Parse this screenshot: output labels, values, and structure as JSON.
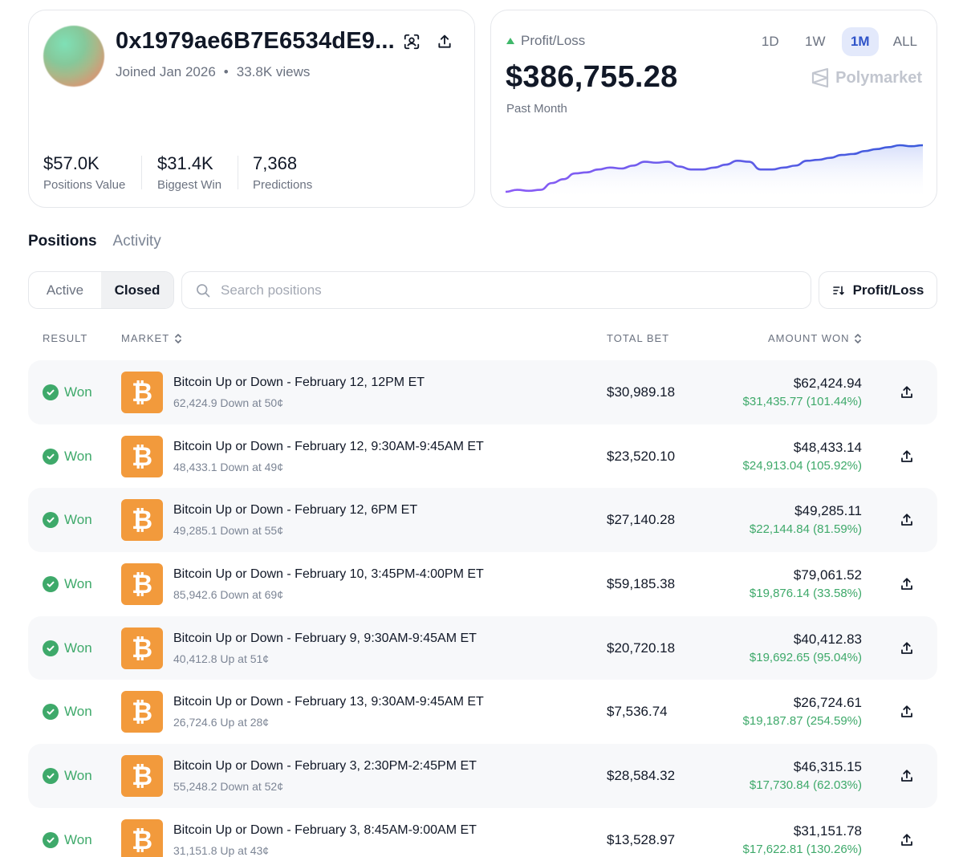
{
  "profile": {
    "address": "0x1979ae6B7E6534dE9...",
    "joined": "Joined Jan 2026",
    "views": "33.8K views",
    "stats": [
      {
        "value": "$57.0K",
        "label": "Positions Value"
      },
      {
        "value": "$31.4K",
        "label": "Biggest Win"
      },
      {
        "value": "7,368",
        "label": "Predictions"
      }
    ]
  },
  "profit_loss": {
    "title": "Profit/Loss",
    "value": "$386,755.28",
    "period": "Past Month",
    "brand": "Polymarket",
    "ranges": [
      "1D",
      "1W",
      "1M",
      "ALL"
    ],
    "active_range": "1M",
    "colors": {
      "line_start": "#8b5cf6",
      "line_end": "#3b5bdb",
      "fill": "#e3e8fb",
      "up": "#3fb86a"
    },
    "chart_data": {
      "type": "area",
      "title": "",
      "xlabel": "",
      "ylabel": "",
      "y": [
        2,
        4,
        3,
        4,
        11,
        15,
        21,
        22,
        25,
        27,
        26,
        29,
        33,
        32,
        33,
        28,
        25,
        25,
        27,
        30,
        34,
        33,
        25,
        25,
        27,
        29,
        34,
        35,
        37,
        40,
        41,
        44,
        46,
        48,
        50,
        49,
        50
      ],
      "grid": false,
      "legend": "none"
    }
  },
  "tabs": [
    {
      "label": "Positions",
      "active": true
    },
    {
      "label": "Activity",
      "active": false
    }
  ],
  "filter": {
    "segments": [
      {
        "label": "Active",
        "active": false
      },
      {
        "label": "Closed",
        "active": true
      }
    ],
    "search_placeholder": "Search positions",
    "sort_label": "Profit/Loss"
  },
  "table": {
    "headers": {
      "result": "RESULT",
      "market": "MARKET",
      "total_bet": "TOTAL BET",
      "amount_won": "AMOUNT WON"
    },
    "rows": [
      {
        "result": "Won",
        "icon": "bitcoin-icon",
        "title": "Bitcoin Up or Down - February 12, 12PM ET",
        "sub": "62,424.9 Down at 50¢",
        "total_bet": "$30,989.18",
        "amount_won": "$62,424.94",
        "profit": "$31,435.77 (101.44%)"
      },
      {
        "result": "Won",
        "icon": "bitcoin-icon",
        "title": "Bitcoin Up or Down - February 12, 9:30AM-9:45AM ET",
        "sub": "48,433.1 Down at 49¢",
        "total_bet": "$23,520.10",
        "amount_won": "$48,433.14",
        "profit": "$24,913.04 (105.92%)"
      },
      {
        "result": "Won",
        "icon": "bitcoin-icon",
        "title": "Bitcoin Up or Down - February 12, 6PM ET",
        "sub": "49,285.1 Down at 55¢",
        "total_bet": "$27,140.28",
        "amount_won": "$49,285.11",
        "profit": "$22,144.84 (81.59%)"
      },
      {
        "result": "Won",
        "icon": "bitcoin-icon",
        "title": "Bitcoin Up or Down - February 10, 3:45PM-4:00PM ET",
        "sub": "85,942.6 Down at 69¢",
        "total_bet": "$59,185.38",
        "amount_won": "$79,061.52",
        "profit": "$19,876.14 (33.58%)"
      },
      {
        "result": "Won",
        "icon": "bitcoin-icon",
        "title": "Bitcoin Up or Down - February 9, 9:30AM-9:45AM ET",
        "sub": "40,412.8 Up at 51¢",
        "total_bet": "$20,720.18",
        "amount_won": "$40,412.83",
        "profit": "$19,692.65 (95.04%)"
      },
      {
        "result": "Won",
        "icon": "bitcoin-icon",
        "title": "Bitcoin Up or Down - February 13, 9:30AM-9:45AM ET",
        "sub": "26,724.6 Up at 28¢",
        "total_bet": "$7,536.74",
        "amount_won": "$26,724.61",
        "profit": "$19,187.87 (254.59%)"
      },
      {
        "result": "Won",
        "icon": "bitcoin-icon",
        "title": "Bitcoin Up or Down - February 3, 2:30PM-2:45PM ET",
        "sub": "55,248.2 Down at 52¢",
        "total_bet": "$28,584.32",
        "amount_won": "$46,315.15",
        "profit": "$17,730.84 (62.03%)"
      },
      {
        "result": "Won",
        "icon": "bitcoin-icon",
        "title": "Bitcoin Up or Down - February 3, 8:45AM-9:00AM ET",
        "sub": "31,151.8 Up at 43¢",
        "total_bet": "$13,528.97",
        "amount_won": "$31,151.78",
        "profit": "$17,622.81 (130.26%)"
      }
    ]
  }
}
